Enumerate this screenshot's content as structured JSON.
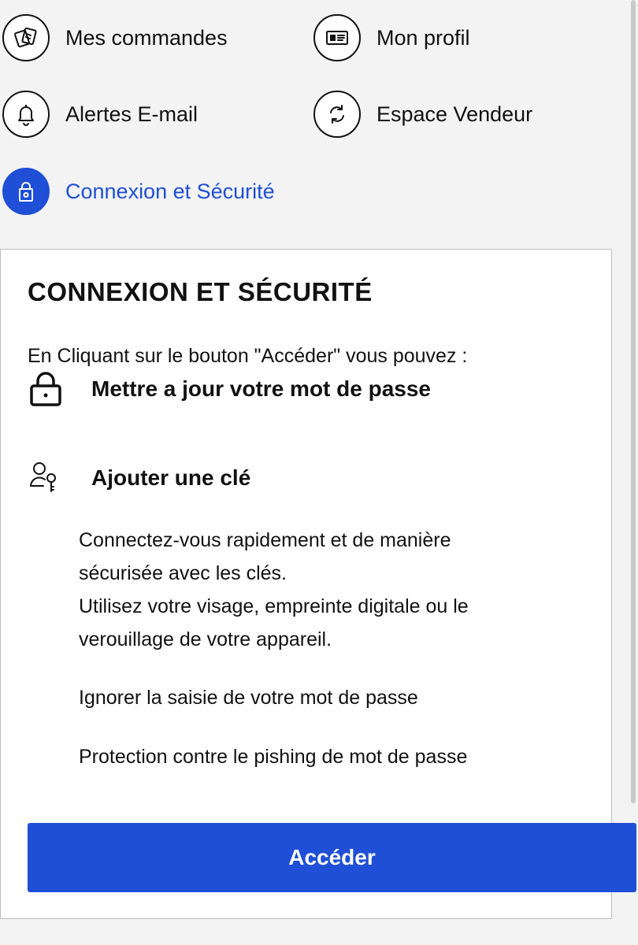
{
  "nav": {
    "items": [
      {
        "label": "Mes commandes",
        "icon": "tickets-icon"
      },
      {
        "label": "Mon profil",
        "icon": "id-card-icon"
      },
      {
        "label": "Alertes E-mail",
        "icon": "bell-icon"
      },
      {
        "label": "Espace Vendeur",
        "icon": "refresh-icon"
      },
      {
        "label": "Connexion et Sécurité",
        "icon": "lock-icon",
        "active": true
      }
    ]
  },
  "card": {
    "title": "CONNEXION ET SÉCURITÉ",
    "intro": "En Cliquant sur le bouton \"Accéder\" vous pouvez :",
    "features": [
      {
        "label": "Mettre a jour votre mot de passe",
        "icon": "lock-icon"
      },
      {
        "label": "Ajouter une clé",
        "icon": "user-key-icon"
      }
    ],
    "passkey_description": [
      "Connectez-vous rapidement et de manière",
      "sécurisée avec les clés.",
      "Utilisez votre visage, empreinte digitale ou le",
      "verouillage de votre appareil."
    ],
    "benefits": [
      "Ignorer la saisie de votre mot de passe",
      "Protection contre le pishing de mot de passe"
    ],
    "button_label": "Accéder"
  },
  "colors": {
    "accent": "#1e4fd6",
    "background": "#f3f3f3",
    "card": "#ffffff",
    "text": "#111111"
  }
}
